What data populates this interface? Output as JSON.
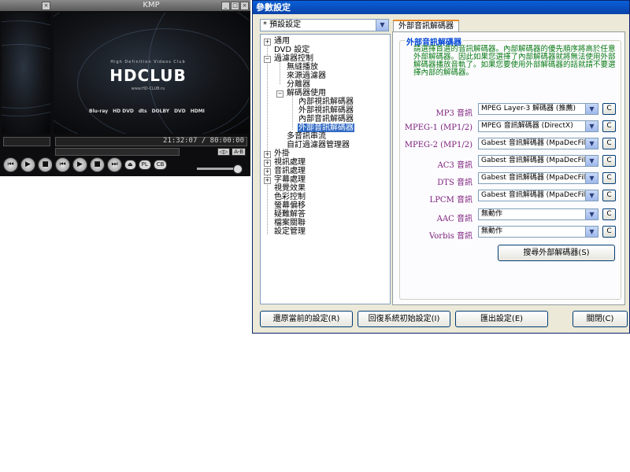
{
  "player": {
    "title": "KMP",
    "logo_tagline": "High Definition Videos Club",
    "logo_text": "HDCLUB",
    "logo_url": "www.HD-CLUB.ru",
    "formats": [
      "Blu-ray",
      "HD DVD",
      "dts",
      "DOLBY",
      "DVD",
      "HDMI"
    ],
    "time": "21:32:07 / 80:00:00",
    "controls": [
      "prev",
      "play",
      "stop",
      "next"
    ],
    "pills": [
      "PL",
      "CB"
    ],
    "small_buttons": [
      "◁▷",
      "A-B"
    ]
  },
  "settings": {
    "title": "參數設定",
    "preset": "* 預設設定",
    "tree": {
      "general": "通用",
      "dvd": "DVD 設定",
      "filter_control": "過濾器控制",
      "seamless": "無縫播放",
      "source_filter": "來源過濾器",
      "splitter": "分離器",
      "decoder_use": "解碼器使用",
      "internal_video": "內部視訊解碼器",
      "external_video": "外部視訊解碼器",
      "internal_audio": "內部音訊解碼器",
      "external_audio": "外部音訊解碼器",
      "multi_audio": "多音訊串流",
      "custom_filter": "自訂過濾器管理器",
      "plugins": "外掛",
      "video": "視訊處理",
      "audio": "音訊處理",
      "subtitle": "字幕處理",
      "visual": "視覺效果",
      "color": "色彩控制",
      "screen_offset": "螢幕偏移",
      "tricky": "疑難解答",
      "assoc": "檔案關聯",
      "settings_mgmt": "設定管理"
    },
    "tab_label": "外部音訊解碼器",
    "group_title": "外部音訊解碼器",
    "description": "請選擇首選的音訊解碼器。內部解碼器的優先順序將高於任意外部解碼器。因此如果您選擇了內部解碼器就將無法使用外部解碼器播放音軌了。如果您要使用外部解碼器的話就請不要選擇內部的解碼器。",
    "decoders": [
      {
        "label": "MP3 音訊",
        "value": "MPEG Layer-3 解碼器 (推薦)"
      },
      {
        "label": "MPEG-1 (MP1/2)",
        "value": "MPEG 音訊解碼器 (DirectX)"
      },
      {
        "label": "MPEG-2 (MP1/2)",
        "value": "Gabest 音訊解碼器 (MpaDecFilter.a"
      },
      {
        "label": "AC3 音訊",
        "value": "Gabest 音訊解碼器 (MpaDecFilter.a"
      },
      {
        "label": "DTS 音訊",
        "value": "Gabest 音訊解碼器 (MpaDecFilter.a"
      },
      {
        "label": "LPCM 音訊",
        "value": "Gabest 音訊解碼器 (MpaDecFilter.a"
      },
      {
        "label": "AAC 音訊",
        "value": "無動作"
      },
      {
        "label": "Vorbis 音訊",
        "value": "無動作"
      }
    ],
    "config_button": "C",
    "search_button": "搜尋外部解碼器(S)",
    "buttons": {
      "restore_current": "還原當前的設定(R)",
      "reset_defaults": "回復系統初始設定(I)",
      "export": "匯出設定(E)",
      "close": "關閉(C)"
    }
  }
}
